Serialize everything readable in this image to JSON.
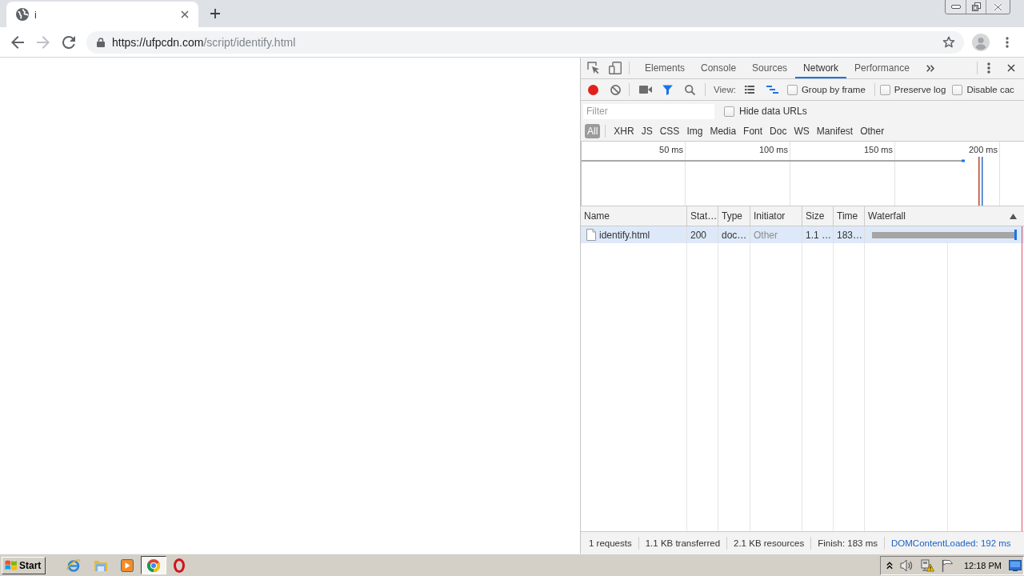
{
  "browser": {
    "tabs": [
      {
        "title": "i",
        "selected": true
      }
    ],
    "navigation": {
      "back_enabled": true,
      "forward_enabled": false
    },
    "address_bar": {
      "host": "https://ufpcdn.com",
      "path": "/script/identify.html"
    }
  },
  "devtools": {
    "panel_tabs": [
      {
        "label": "Elements",
        "selected": false
      },
      {
        "label": "Console",
        "selected": false
      },
      {
        "label": "Sources",
        "selected": false
      },
      {
        "label": "Network",
        "selected": true
      },
      {
        "label": "Performance",
        "selected": false
      }
    ],
    "toolbar": {
      "recording": true,
      "filter_shown": true,
      "view_label": "View:",
      "large_rows": false,
      "overview_shown": true,
      "options": [
        {
          "label": "Group by frame",
          "checked": false
        },
        {
          "label": "Preserve log",
          "checked": false
        },
        {
          "label": "Disable cac",
          "checked": false
        }
      ]
    },
    "filter": {
      "placeholder": "Filter",
      "options": [
        {
          "label": "Hide data URLs",
          "checked": false
        }
      ]
    },
    "type_filters": [
      {
        "label": "All",
        "selected": true
      },
      {
        "label": "XHR",
        "selected": false
      },
      {
        "label": "JS",
        "selected": false
      },
      {
        "label": "CSS",
        "selected": false
      },
      {
        "label": "Img",
        "selected": false
      },
      {
        "label": "Media",
        "selected": false
      },
      {
        "label": "Font",
        "selected": false
      },
      {
        "label": "Doc",
        "selected": false
      },
      {
        "label": "WS",
        "selected": false
      },
      {
        "label": "Manifest",
        "selected": false
      },
      {
        "label": "Other",
        "selected": false
      }
    ],
    "overview": {
      "ticks": [
        "50 ms",
        "100 ms",
        "150 ms",
        "200 ms"
      ]
    },
    "table": {
      "columns": [
        {
          "label": "Name",
          "sorted": false
        },
        {
          "label": "Stat…",
          "sorted": false
        },
        {
          "label": "Type",
          "sorted": false
        },
        {
          "label": "Initiator",
          "sorted": false
        },
        {
          "label": "Size",
          "sorted": false
        },
        {
          "label": "Time",
          "sorted": false
        },
        {
          "label": "Waterfall",
          "sorted": true
        }
      ],
      "rows": [
        {
          "name": "identify.html",
          "status": "200",
          "type": "doc…",
          "initiator": "Other",
          "size": "1.1 …",
          "time": "183…",
          "selected": true
        }
      ]
    },
    "summary": [
      {
        "text": "1 requests",
        "kind": "plain"
      },
      {
        "text": "1.1 KB transferred",
        "kind": "plain"
      },
      {
        "text": "2.1 KB resources",
        "kind": "plain"
      },
      {
        "text": "Finish: 183 ms",
        "kind": "plain"
      },
      {
        "text": "DOMContentLoaded: 192 ms",
        "kind": "event"
      }
    ]
  },
  "taskbar": {
    "start_label": "Start",
    "apps": [
      {
        "kind": "e",
        "selected": false
      },
      {
        "kind": "folder",
        "selected": false
      },
      {
        "kind": "play",
        "selected": false
      },
      {
        "kind": "ring",
        "selected": true
      },
      {
        "kind": "o",
        "selected": false
      }
    ],
    "clock": "12:18 PM"
  }
}
